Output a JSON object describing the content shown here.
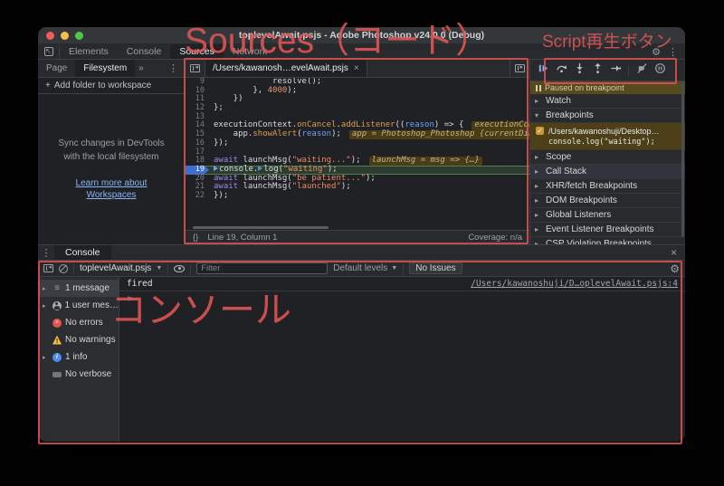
{
  "window": {
    "title": "toplevelAwait.psjs - Adobe Photoshop v24.0.0 (Debug)"
  },
  "tabbar": {
    "tabs": [
      {
        "label": "Elements",
        "active": false
      },
      {
        "label": "Console",
        "active": false
      },
      {
        "label": "Sources",
        "active": true
      },
      {
        "label": "Network",
        "active": false
      }
    ]
  },
  "nav": {
    "tabs": [
      {
        "label": "Page",
        "active": false
      },
      {
        "label": "Filesystem",
        "active": true
      }
    ],
    "overflow": "»",
    "plus": "+",
    "add_folder": "Add folder to workspace",
    "sync_line_1": "Sync changes in DevTools",
    "sync_line_2": "with the local filesystem",
    "link_line_1": "Learn more about",
    "link_line_2": "Workspaces"
  },
  "editor": {
    "file_tab": "/Users/kawanosh…evelAwait.psjs",
    "close": "×",
    "lines": [
      {
        "n": 9,
        "seg": [
          [
            "p",
            "            resolve();"
          ]
        ]
      },
      {
        "n": 10,
        "seg": [
          [
            "p",
            "        }, "
          ],
          [
            "n",
            "4000"
          ],
          [
            "p",
            ");"
          ]
        ]
      },
      {
        "n": 11,
        "seg": [
          [
            "p",
            "    })"
          ]
        ]
      },
      {
        "n": 12,
        "seg": [
          [
            "p",
            "};"
          ]
        ]
      },
      {
        "n": 13,
        "seg": []
      },
      {
        "n": 14,
        "seg": [
          [
            "p",
            "executionContext."
          ],
          [
            "prop",
            "onCancel"
          ],
          [
            "p",
            "."
          ],
          [
            "prop",
            "addListener"
          ],
          [
            "p",
            "(("
          ],
          [
            "param",
            "reason"
          ],
          [
            "p",
            ") => {"
          ]
        ],
        "eval": "executionContext = {"
      },
      {
        "n": 15,
        "seg": [
          [
            "p",
            "    app."
          ],
          [
            "prop",
            "showAlert"
          ],
          [
            "p",
            "("
          ],
          [
            "param",
            "reason"
          ],
          [
            "p",
            ");"
          ]
        ],
        "eval": "app = Photoshop_Photoshop {currentDialogMode:"
      },
      {
        "n": 16,
        "seg": [
          [
            "p",
            "});"
          ]
        ]
      },
      {
        "n": 17,
        "seg": []
      },
      {
        "n": 18,
        "seg": [
          [
            "k",
            "await"
          ],
          [
            "p",
            " launchMsg("
          ],
          [
            "s",
            "\"waiting...\""
          ],
          [
            "p",
            ");"
          ]
        ],
        "eval": "launchMsg = msg => {…}"
      },
      {
        "n": 19,
        "seg": [
          [
            "m",
            ""
          ],
          [
            "p",
            "console."
          ],
          [
            "m2",
            ""
          ],
          [
            "p",
            "log("
          ],
          [
            "s",
            "\"waiting\""
          ],
          [
            "p",
            ");"
          ]
        ],
        "current": true,
        "breakpoint": true
      },
      {
        "n": 20,
        "seg": [
          [
            "k",
            "await"
          ],
          [
            "p",
            " launchMsg("
          ],
          [
            "s",
            "\"be patient...\""
          ],
          [
            "p",
            ");"
          ]
        ]
      },
      {
        "n": 21,
        "seg": [
          [
            "k",
            "await"
          ],
          [
            "p",
            " launchMsg("
          ],
          [
            "s",
            "\"launched\""
          ],
          [
            "p",
            ");"
          ]
        ]
      },
      {
        "n": 22,
        "seg": [
          [
            "p",
            "});"
          ]
        ]
      }
    ],
    "status": {
      "brackets": "{}",
      "line_col": "Line 19, Column 1",
      "coverage": "Coverage: n/a"
    }
  },
  "debugger": {
    "controls": [
      "resume",
      "step-over",
      "step-into",
      "step-out",
      "step",
      "sep",
      "deactivate-breakpoints",
      "pause-on-exceptions"
    ],
    "paused_message": "Paused on breakpoint",
    "sections": [
      {
        "label": "Watch"
      },
      {
        "label": "Breakpoints",
        "expanded": true
      },
      {
        "label": "Scope"
      },
      {
        "label": "Call Stack",
        "paused": true
      },
      {
        "label": "XHR/fetch Breakpoints"
      },
      {
        "label": "DOM Breakpoints"
      },
      {
        "label": "Global Listeners"
      },
      {
        "label": "Event Listener Breakpoints"
      },
      {
        "label": "CSP Violation Breakpoints"
      }
    ],
    "breakpoint_entry": {
      "checked": true,
      "path": "/Users/kawanoshuji/Desktop…",
      "code": "console.log(\"waiting\");"
    }
  },
  "console": {
    "tab_label": "Console",
    "close": "×",
    "context": "toplevelAwait.psjs",
    "filter_placeholder": "Filter",
    "levels": "Default levels",
    "issues": "No Issues",
    "sidebar": [
      {
        "icon": "list",
        "label": "1 message",
        "expand": true,
        "selected": true
      },
      {
        "icon": "user",
        "label": "1 user mes…",
        "expand": true
      },
      {
        "icon": "error",
        "label": "No errors"
      },
      {
        "icon": "warning",
        "label": "No warnings"
      },
      {
        "icon": "info",
        "label": "1 info",
        "expand": true
      },
      {
        "icon": "verbose",
        "label": "No verbose"
      }
    ],
    "message": {
      "text": "fired",
      "source": "/Users/kawanoshuji/D…oplevelAwait.psjs:4",
      "prompt": ">"
    }
  },
  "annotations": {
    "sources_label": "Sources（コード）",
    "script_label": "Script再生ボタン",
    "console_label": "コンソール"
  },
  "colors": {
    "annotation_red": "#e05252",
    "accent_blue": "#8ab4f8",
    "breakpoint_blue": "#3d6fd1",
    "paused_olive": "#564a1e",
    "exec_line_green": "#4e7d4e"
  }
}
